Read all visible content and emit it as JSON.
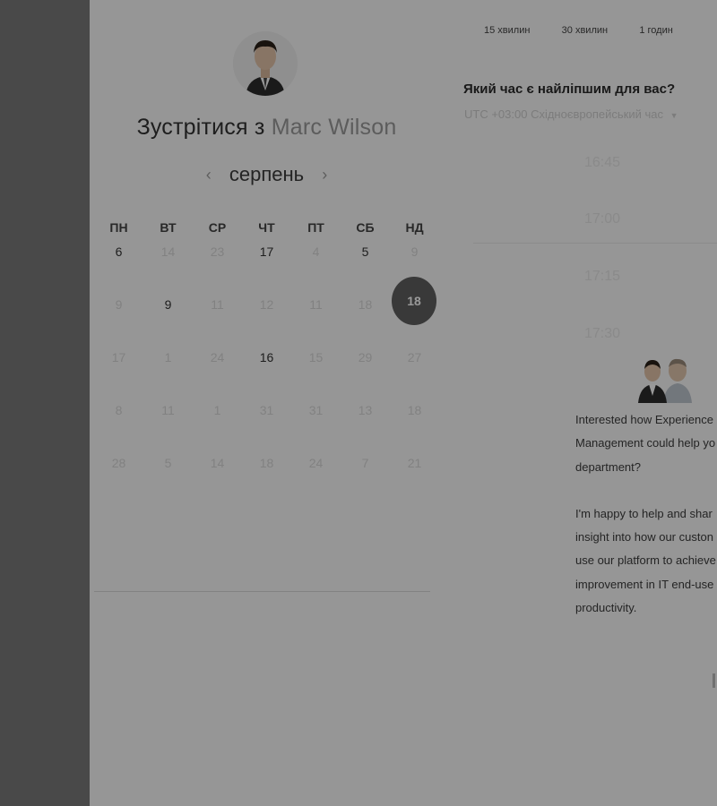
{
  "durations": [
    "15 хвилин",
    "30 хвилин",
    "1 годин"
  ],
  "title": {
    "prefix": "Зустрітися з",
    "name": "Marc Wilson"
  },
  "month": "серпень",
  "weekdays": [
    "ПН",
    "ВТ",
    "СР",
    "ЧТ",
    "ПТ",
    "СБ",
    "НД"
  ],
  "calendar": {
    "weeks": [
      [
        {
          "d": "6",
          "a": true
        },
        {
          "d": "14",
          "a": false
        },
        {
          "d": "23",
          "a": false
        },
        {
          "d": "17",
          "a": true
        },
        {
          "d": "4",
          "a": false
        },
        {
          "d": "5",
          "a": true
        },
        {
          "d": "9",
          "a": false
        }
      ],
      [
        {
          "d": "9",
          "a": false
        },
        {
          "d": "9",
          "a": true
        },
        {
          "d": "11",
          "a": false
        },
        {
          "d": "12",
          "a": false
        },
        {
          "d": "11",
          "a": false
        },
        {
          "d": "18",
          "a": false
        },
        {
          "d": "18",
          "a": true,
          "selected": true
        }
      ],
      [
        {
          "d": "17",
          "a": false
        },
        {
          "d": "1",
          "a": false
        },
        {
          "d": "24",
          "a": false
        },
        {
          "d": "16",
          "a": true
        },
        {
          "d": "15",
          "a": false
        },
        {
          "d": "29",
          "a": false
        },
        {
          "d": "27",
          "a": false
        }
      ],
      [
        {
          "d": "8",
          "a": false
        },
        {
          "d": "11",
          "a": false
        },
        {
          "d": "1",
          "a": false
        },
        {
          "d": "31",
          "a": false
        },
        {
          "d": "31",
          "a": false
        },
        {
          "d": "13",
          "a": false
        },
        {
          "d": "18",
          "a": false
        }
      ],
      [
        {
          "d": "28",
          "a": false
        },
        {
          "d": "5",
          "a": false
        },
        {
          "d": "14",
          "a": false
        },
        {
          "d": "18",
          "a": false
        },
        {
          "d": "24",
          "a": false
        },
        {
          "d": "7",
          "a": false
        },
        {
          "d": "21",
          "a": false
        }
      ]
    ]
  },
  "time_question": "Який час є найліпшим для вас?",
  "timezone": "UTC +03:00 Східноєвропейський час",
  "time_slots": [
    "16:45",
    "17:00",
    "17:15",
    "17:30"
  ],
  "info": {
    "para1": [
      "Interested how Experience",
      "Management could help yo",
      "department?"
    ],
    "para2": [
      "I'm happy to help and shar",
      "insight into how our custon",
      "use our platform to achieve",
      "improvement in IT end-use",
      "productivity."
    ]
  },
  "colors": {
    "selected": "#5f5f5f",
    "backdrop": "#7b7b7b"
  }
}
